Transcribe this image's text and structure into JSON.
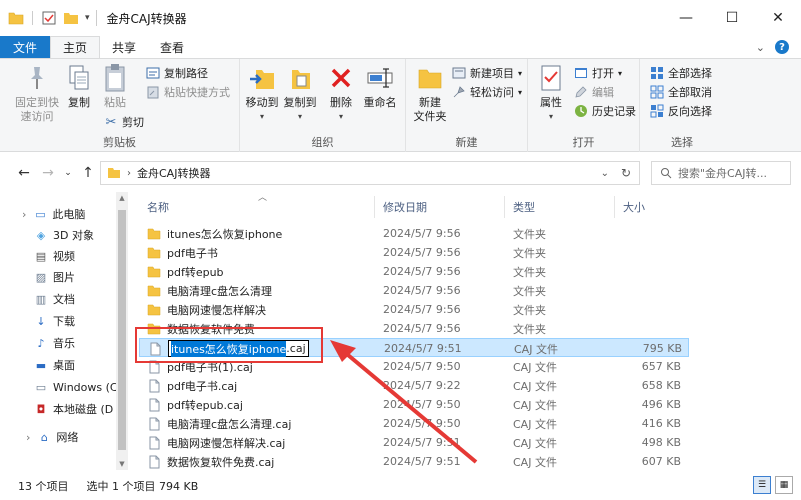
{
  "window": {
    "title": "金舟CAJ转换器",
    "minimize": "—",
    "maximize": "☐",
    "close": "✕"
  },
  "tabs": {
    "file": "文件",
    "home": "主页",
    "share": "共享",
    "view": "查看"
  },
  "ribbon": {
    "clipboard": {
      "label": "剪贴板",
      "pin_quick": "固定到快\n速访问",
      "copy": "复制",
      "paste": "粘贴",
      "copy_path": "复制路径",
      "paste_shortcut": "粘贴快捷方式",
      "cut": "剪切"
    },
    "organize": {
      "label": "组织",
      "move_to": "移动到",
      "copy_to": "复制到",
      "delete": "删除",
      "rename": "重命名"
    },
    "new": {
      "label": "新建",
      "new_folder": "新建\n文件夹",
      "new_item": "新建项目",
      "easy_access": "轻松访问"
    },
    "open": {
      "label": "打开",
      "properties": "属性",
      "open": "打开",
      "edit": "编辑",
      "history": "历史记录"
    },
    "select": {
      "label": "选择",
      "select_all": "全部选择",
      "select_none": "全部取消",
      "invert": "反向选择"
    }
  },
  "address": {
    "crumb": "金舟CAJ转换器",
    "search_placeholder": "搜索\"金舟CAJ转..."
  },
  "nav": {
    "items": [
      {
        "label": "此电脑",
        "icon": "pc-icon"
      },
      {
        "label": "3D 对象",
        "icon": "cube-icon"
      },
      {
        "label": "视频",
        "icon": "video-icon"
      },
      {
        "label": "图片",
        "icon": "picture-icon"
      },
      {
        "label": "文档",
        "icon": "document-icon"
      },
      {
        "label": "下载",
        "icon": "download-icon"
      },
      {
        "label": "音乐",
        "icon": "music-icon"
      },
      {
        "label": "桌面",
        "icon": "desktop-icon"
      },
      {
        "label": "Windows (C",
        "icon": "windows-drive-icon"
      },
      {
        "label": "本地磁盘 (D",
        "icon": "disk-icon"
      },
      {
        "label": "网络",
        "icon": "network-icon"
      }
    ]
  },
  "columns": {
    "name": "名称",
    "date": "修改日期",
    "type": "类型",
    "size": "大小"
  },
  "files": [
    {
      "name": "itunes怎么恢复iphone",
      "date": "2024/5/7 9:56",
      "type": "文件夹",
      "size": "",
      "kind": "folder"
    },
    {
      "name": "pdf电子书",
      "date": "2024/5/7 9:56",
      "type": "文件夹",
      "size": "",
      "kind": "folder"
    },
    {
      "name": "pdf转epub",
      "date": "2024/5/7 9:56",
      "type": "文件夹",
      "size": "",
      "kind": "folder"
    },
    {
      "name": "电脑清理c盘怎么清理",
      "date": "2024/5/7 9:56",
      "type": "文件夹",
      "size": "",
      "kind": "folder"
    },
    {
      "name": "电脑网速慢怎样解决",
      "date": "2024/5/7 9:56",
      "type": "文件夹",
      "size": "",
      "kind": "folder"
    },
    {
      "name": "数据恢复软件免费",
      "date": "2024/5/7 9:56",
      "type": "文件夹",
      "size": "",
      "kind": "folder"
    },
    {
      "name": "itunes怎么恢复iphone.caj",
      "date": "2024/5/7 9:51",
      "type": "CAJ 文件",
      "size": "795 KB",
      "kind": "file"
    },
    {
      "name": "pdf电子书(1).caj",
      "date": "2024/5/7 9:50",
      "type": "CAJ 文件",
      "size": "657 KB",
      "kind": "file"
    },
    {
      "name": "pdf电子书.caj",
      "date": "2024/5/7 9:22",
      "type": "CAJ 文件",
      "size": "658 KB",
      "kind": "file"
    },
    {
      "name": "pdf转epub.caj",
      "date": "2024/5/7 9:50",
      "type": "CAJ 文件",
      "size": "496 KB",
      "kind": "file"
    },
    {
      "name": "电脑清理c盘怎么清理.caj",
      "date": "2024/5/7 9:50",
      "type": "CAJ 文件",
      "size": "416 KB",
      "kind": "file"
    },
    {
      "name": "电脑网速慢怎样解决.caj",
      "date": "2024/5/7 9:51",
      "type": "CAJ 文件",
      "size": "498 KB",
      "kind": "file"
    },
    {
      "name": "数据恢复软件免费.caj",
      "date": "2024/5/7 9:51",
      "type": "CAJ 文件",
      "size": "607 KB",
      "kind": "file"
    }
  ],
  "rename": {
    "selected_part": "itunes怎么恢复iphone",
    "ext_part": ".caj"
  },
  "status": {
    "count": "13 个项目",
    "selected": "选中 1 个项目  794 KB"
  },
  "colors": {
    "accent": "#1979ca",
    "selection": "#cce8ff",
    "annotation": "#e53935"
  }
}
